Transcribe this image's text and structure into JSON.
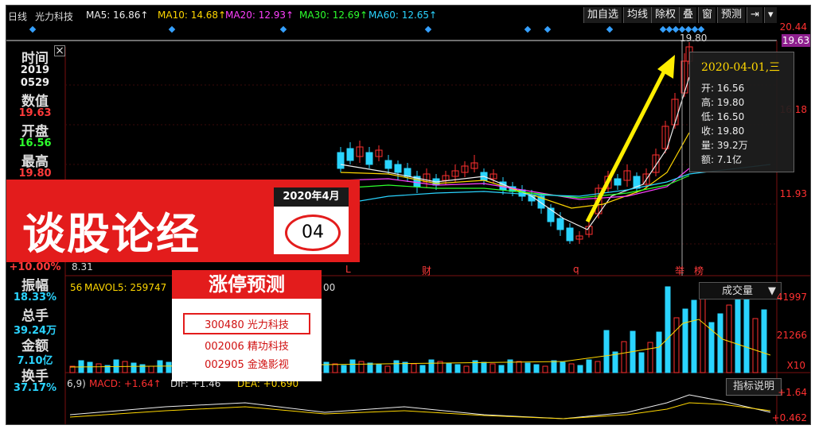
{
  "header": {
    "period": "日线",
    "stock": "光力科技",
    "ma": [
      {
        "label": "MA5: 16.86↑",
        "color": "#eeeeee"
      },
      {
        "label": "MA10: 14.68↑",
        "color": "#ffd700"
      },
      {
        "label": "MA20: 12.93↑",
        "color": "#ff40ff"
      },
      {
        "label": "MA30: 12.69↑",
        "color": "#2dff2d"
      },
      {
        "label": "MA60: 12.65↑",
        "color": "#2ad4ff"
      }
    ],
    "buttons": [
      "加自选",
      "均线",
      "除权",
      "叠",
      "窗",
      "预测",
      "⇥",
      "▾"
    ]
  },
  "price_axis": {
    "top": "20.44",
    "tag": "19.63",
    "mid": "16.18",
    "low": "11.93",
    "hi_marker": "19.80"
  },
  "left_panel": [
    {
      "k": "时间"
    },
    {
      "v": "2019",
      "c": "wt"
    },
    {
      "v": "0529",
      "c": "wt"
    },
    {
      "k": "数值"
    },
    {
      "v": "19.63",
      "c": "red"
    },
    {
      "k": "开盘"
    },
    {
      "v": "16.56",
      "c": "green"
    },
    {
      "k": "最高"
    },
    {
      "v": "19.80",
      "c": "red"
    }
  ],
  "left_panel_lower": [
    {
      "v": "+10.00%",
      "c": "red"
    },
    {
      "k": "振幅"
    },
    {
      "v": "18.33%",
      "c": "cyan"
    },
    {
      "k": "总手"
    },
    {
      "v": "39.24万",
      "c": "cyan"
    },
    {
      "k": "金额"
    },
    {
      "v": "7.10亿",
      "c": "cyan"
    },
    {
      "k": "换手"
    },
    {
      "v": "37.17%",
      "c": "cyan"
    }
  ],
  "tooltip": {
    "date": "2020-04-01,三",
    "rows": [
      "开: 16.56",
      "高: 19.80",
      "低: 16.50",
      "收: 19.80",
      "量: 39.2万",
      "额: 7.1亿"
    ]
  },
  "markers": {
    "L": "L",
    "cai": "财",
    "q": "q",
    "ju": "举",
    "bang": "榜",
    "low_price": "8.31"
  },
  "volume": {
    "label": "MAVOL5: 259747",
    "trail": "00",
    "select": "成交量",
    "axis_top": "41997",
    "axis_mid": "21266",
    "unit": "X10"
  },
  "macd": {
    "label": "MACD: +1.64↑",
    "cut": "6,9)",
    "dif": "DIF: +1.46",
    "dea": "DEA: +0.690",
    "axis_top": "+1.64",
    "axis_bot": "+0.462",
    "explain": "指标说明"
  },
  "banner": {
    "title": "谈股论经",
    "date": "2020年4月",
    "num": "04"
  },
  "prediction": {
    "title": "涨停预测",
    "items": [
      "300480 光力科技",
      "002006 精功科技",
      "002905 金逸影视"
    ]
  },
  "colors": {
    "up": "#ff3030",
    "down": "#2ad4ff",
    "arrow": "#ffee00"
  }
}
